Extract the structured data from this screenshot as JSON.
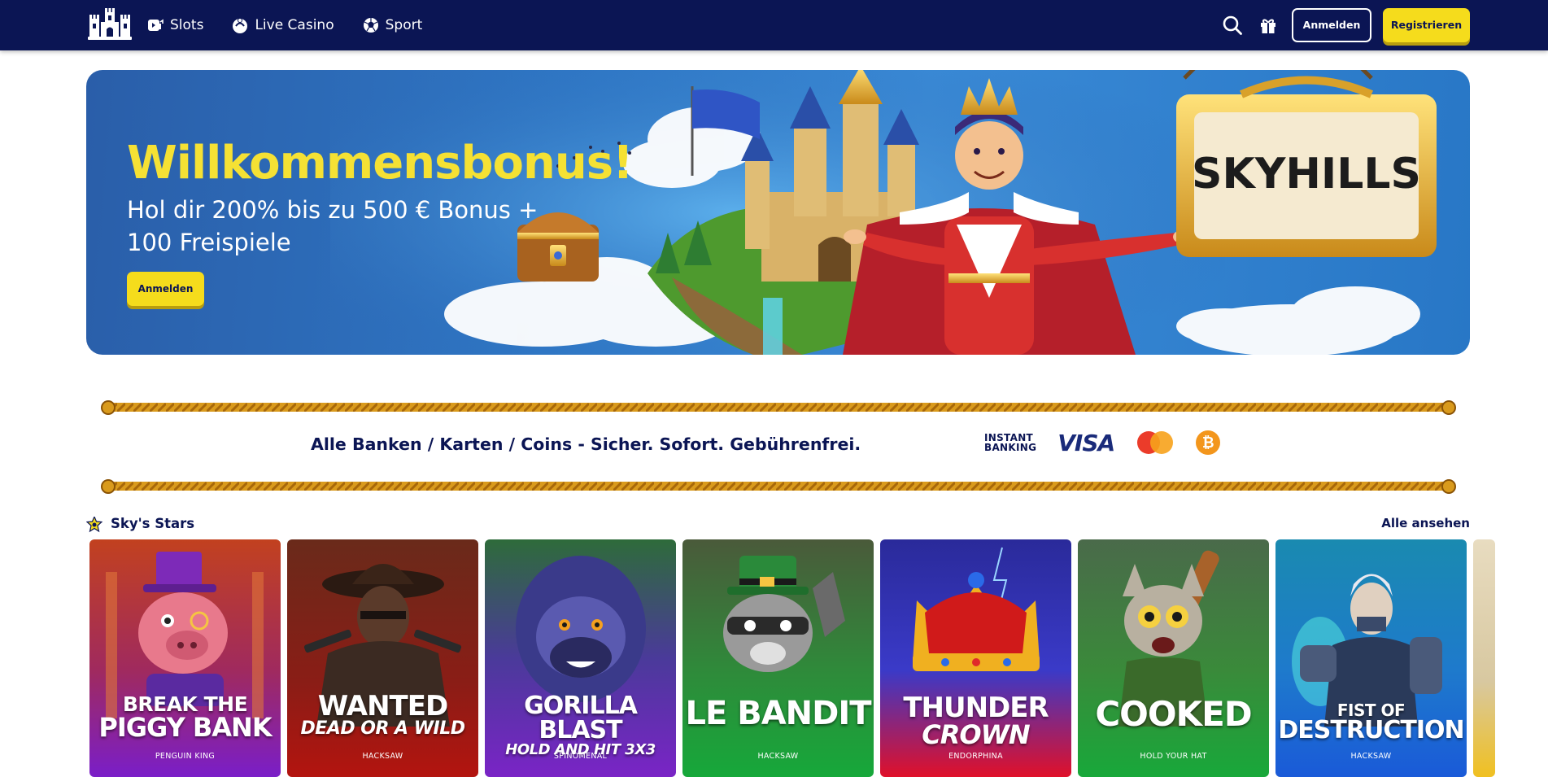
{
  "header": {
    "nav": [
      {
        "label": "Slots",
        "icon": "slot-machine-icon"
      },
      {
        "label": "Live Casino",
        "icon": "live-casino-icon"
      },
      {
        "label": "Sport",
        "icon": "sport-ball-icon"
      }
    ],
    "login_label": "Anmelden",
    "register_label": "Registrieren",
    "colors": {
      "background": "#0b1554",
      "accent": "#f5dc1c"
    }
  },
  "hero": {
    "title": "Willkommensbonus!",
    "subtitle": "Hol dir 200% bis zu 500 € Bonus + 100 Freispiele",
    "cta_label": "Anmelden",
    "sign_text": "SKYHILLS"
  },
  "payments": {
    "text": "Alle Banken / Karten / Coins - Sicher. Sofort. Gebührenfrei.",
    "instant_line1": "INSTANT",
    "instant_line2": "BANKING",
    "visa": "VISA",
    "bitcoin_symbol": "₿"
  },
  "stars": {
    "title": "Sky's Stars",
    "view_all": "Alle ansehen",
    "games": [
      {
        "line1": "BREAK THE",
        "line2": "PIGGY BANK",
        "provider": "PENGUIN KING"
      },
      {
        "line1": "WANTED",
        "line2": "DEAD OR A WILD",
        "provider": "HACKSAW"
      },
      {
        "line1": "GORILLA BLAST",
        "line2": "HOLD AND HIT 3X3",
        "provider": "SPINOMENAL"
      },
      {
        "line1": "LE BANDIT",
        "line2": "",
        "provider": "HACKSAW"
      },
      {
        "line1": "THUNDER",
        "line2": "CROWN",
        "provider": "ENDORPHINA"
      },
      {
        "line1": "COOKED",
        "line2": "",
        "provider": "HOLD YOUR HAT"
      },
      {
        "line1": "FIST OF",
        "line2": "DESTRUCTION",
        "provider": "HACKSAW"
      }
    ]
  }
}
